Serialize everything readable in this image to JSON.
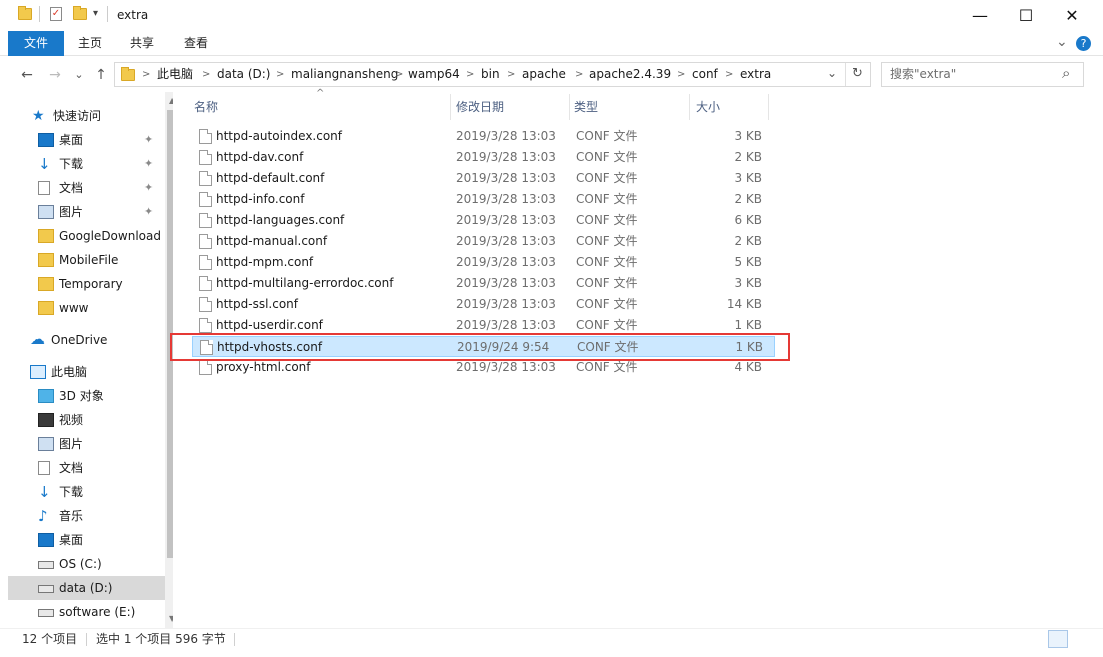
{
  "window": {
    "title": "extra",
    "min_glyph": "—",
    "max_glyph": "☐",
    "close_glyph": "✕"
  },
  "ribbon": {
    "tabs": [
      "文件",
      "主页",
      "共享",
      "查看"
    ],
    "expand_glyph": "⌄",
    "help_glyph": "?"
  },
  "nav": {
    "back": "←",
    "forward": "→",
    "recent": "⌄",
    "up": "↑",
    "dropdown": "⌄",
    "refresh": "↻"
  },
  "breadcrumb": [
    "此电脑",
    "data (D:)",
    "maliangnansheng",
    "wamp64",
    "bin",
    "apache",
    "apache2.4.39",
    "conf",
    "extra"
  ],
  "search": {
    "placeholder": "搜索\"extra\"",
    "icon": "⌕"
  },
  "sidebar": {
    "items": [
      {
        "label": "快速访问",
        "icon": "star-icon",
        "pinned": false
      },
      {
        "label": "桌面",
        "icon": "desktop-icon",
        "pinned": true
      },
      {
        "label": "下载",
        "icon": "download-icon",
        "pinned": true
      },
      {
        "label": "文档",
        "icon": "document-icon",
        "pinned": true
      },
      {
        "label": "图片",
        "icon": "pictures-icon",
        "pinned": true
      },
      {
        "label": "GoogleDownload",
        "icon": "folder-icon",
        "pinned": false
      },
      {
        "label": "MobileFile",
        "icon": "folder-icon",
        "pinned": false
      },
      {
        "label": "Temporary",
        "icon": "folder-icon",
        "pinned": false
      },
      {
        "label": "www",
        "icon": "folder-icon",
        "pinned": false
      },
      {
        "label": "OneDrive",
        "icon": "cloud-icon",
        "pinned": false
      },
      {
        "label": "此电脑",
        "icon": "computer-icon",
        "pinned": false
      },
      {
        "label": "3D 对象",
        "icon": "cube-icon",
        "pinned": false
      },
      {
        "label": "视频",
        "icon": "video-icon",
        "pinned": false
      },
      {
        "label": "图片",
        "icon": "pictures-icon",
        "pinned": false
      },
      {
        "label": "文档",
        "icon": "document-icon",
        "pinned": false
      },
      {
        "label": "下载",
        "icon": "download-icon",
        "pinned": false
      },
      {
        "label": "音乐",
        "icon": "music-icon",
        "pinned": false
      },
      {
        "label": "桌面",
        "icon": "desktop-icon",
        "pinned": false
      },
      {
        "label": "OS (C:)",
        "icon": "drive-icon",
        "pinned": false
      },
      {
        "label": "data (D:)",
        "icon": "drive-icon",
        "pinned": false,
        "selected": true
      },
      {
        "label": "software (E:)",
        "icon": "drive-icon",
        "pinned": false
      }
    ],
    "pin_glyph": "📌"
  },
  "columns": {
    "name": "名称",
    "date": "修改日期",
    "type": "类型",
    "size": "大小",
    "sort_glyph": "^"
  },
  "files": [
    {
      "name": "httpd-autoindex.conf",
      "date": "2019/3/28 13:03",
      "type": "CONF 文件",
      "size": "3 KB"
    },
    {
      "name": "httpd-dav.conf",
      "date": "2019/3/28 13:03",
      "type": "CONF 文件",
      "size": "2 KB"
    },
    {
      "name": "httpd-default.conf",
      "date": "2019/3/28 13:03",
      "type": "CONF 文件",
      "size": "3 KB"
    },
    {
      "name": "httpd-info.conf",
      "date": "2019/3/28 13:03",
      "type": "CONF 文件",
      "size": "2 KB"
    },
    {
      "name": "httpd-languages.conf",
      "date": "2019/3/28 13:03",
      "type": "CONF 文件",
      "size": "6 KB"
    },
    {
      "name": "httpd-manual.conf",
      "date": "2019/3/28 13:03",
      "type": "CONF 文件",
      "size": "2 KB"
    },
    {
      "name": "httpd-mpm.conf",
      "date": "2019/3/28 13:03",
      "type": "CONF 文件",
      "size": "5 KB"
    },
    {
      "name": "httpd-multilang-errordoc.conf",
      "date": "2019/3/28 13:03",
      "type": "CONF 文件",
      "size": "3 KB"
    },
    {
      "name": "httpd-ssl.conf",
      "date": "2019/3/28 13:03",
      "type": "CONF 文件",
      "size": "14 KB"
    },
    {
      "name": "httpd-userdir.conf",
      "date": "2019/3/28 13:03",
      "type": "CONF 文件",
      "size": "1 KB"
    },
    {
      "name": "httpd-vhosts.conf",
      "date": "2019/9/24 9:54",
      "type": "CONF 文件",
      "size": "1 KB",
      "selected": true
    },
    {
      "name": "proxy-html.conf",
      "date": "2019/3/28 13:03",
      "type": "CONF 文件",
      "size": "4 KB"
    }
  ],
  "status": {
    "count": "12 个项目",
    "selection": "选中 1 个项目 596 字节"
  },
  "colors": {
    "accent": "#1979ca",
    "selection_bg": "#cce8ff",
    "highlight_border": "#e53935"
  }
}
